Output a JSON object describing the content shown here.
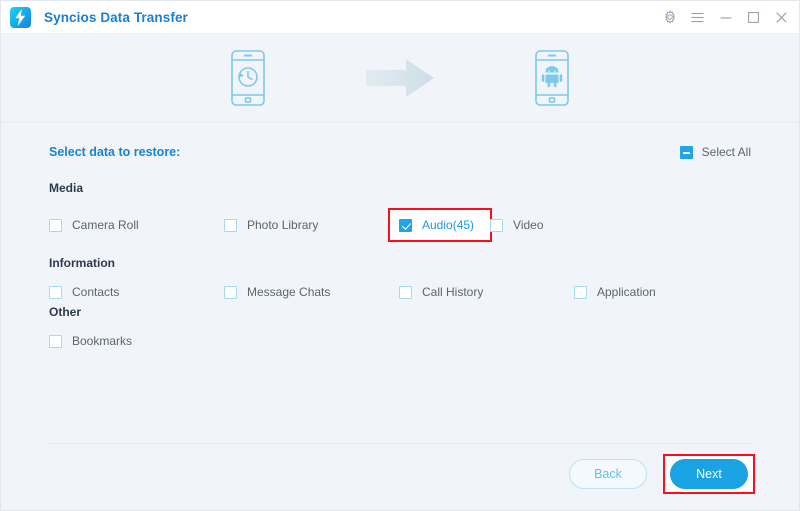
{
  "window": {
    "app_title": "Syncios Data Transfer",
    "logo_icon": "syncios-lightning-logo",
    "controls": [
      {
        "name": "settings-gear",
        "label": "gear-icon"
      },
      {
        "name": "menu",
        "label": "hamburger-menu-icon"
      },
      {
        "name": "minimize",
        "label": "minimize-icon"
      },
      {
        "name": "maximize",
        "label": "maximize-icon"
      },
      {
        "name": "close",
        "label": "close-icon"
      }
    ]
  },
  "header": {
    "source_device_icon": "phone-backup-restore-icon",
    "transfer_arrow_icon": "right-arrow-icon",
    "target_device_icon": "phone-android-icon"
  },
  "main": {
    "select_label": "Select data to restore:",
    "select_all_label": "Select All",
    "select_all_state": "indeterminate",
    "groups": [
      {
        "title": "Media",
        "items": [
          {
            "label": "Camera Roll",
            "checked": false,
            "highlighted": false
          },
          {
            "label": "Photo Library",
            "checked": false,
            "highlighted": false
          },
          {
            "label": "Audio(45)",
            "checked": true,
            "highlighted": true
          },
          {
            "label": "Video",
            "checked": false,
            "highlighted": false
          }
        ]
      },
      {
        "title": "Information",
        "items": [
          {
            "label": "Contacts",
            "checked": false,
            "highlighted": false
          },
          {
            "label": "Message Chats",
            "checked": false,
            "highlighted": false
          },
          {
            "label": "Call History",
            "checked": false,
            "highlighted": false
          },
          {
            "label": "Application",
            "checked": false,
            "highlighted": false
          }
        ]
      },
      {
        "title": "Other",
        "items": [
          {
            "label": "Bookmarks",
            "checked": false,
            "highlighted": false
          }
        ]
      }
    ]
  },
  "footer": {
    "back_label": "Back",
    "next_label": "Next",
    "next_highlighted": true
  },
  "colors": {
    "accent_blue": "#19a3e2",
    "title_blue": "#1a7fd4",
    "body_bg": "#f1f4f8",
    "highlight_red": "#fc0d1b",
    "label_gray": "#5d6570"
  }
}
